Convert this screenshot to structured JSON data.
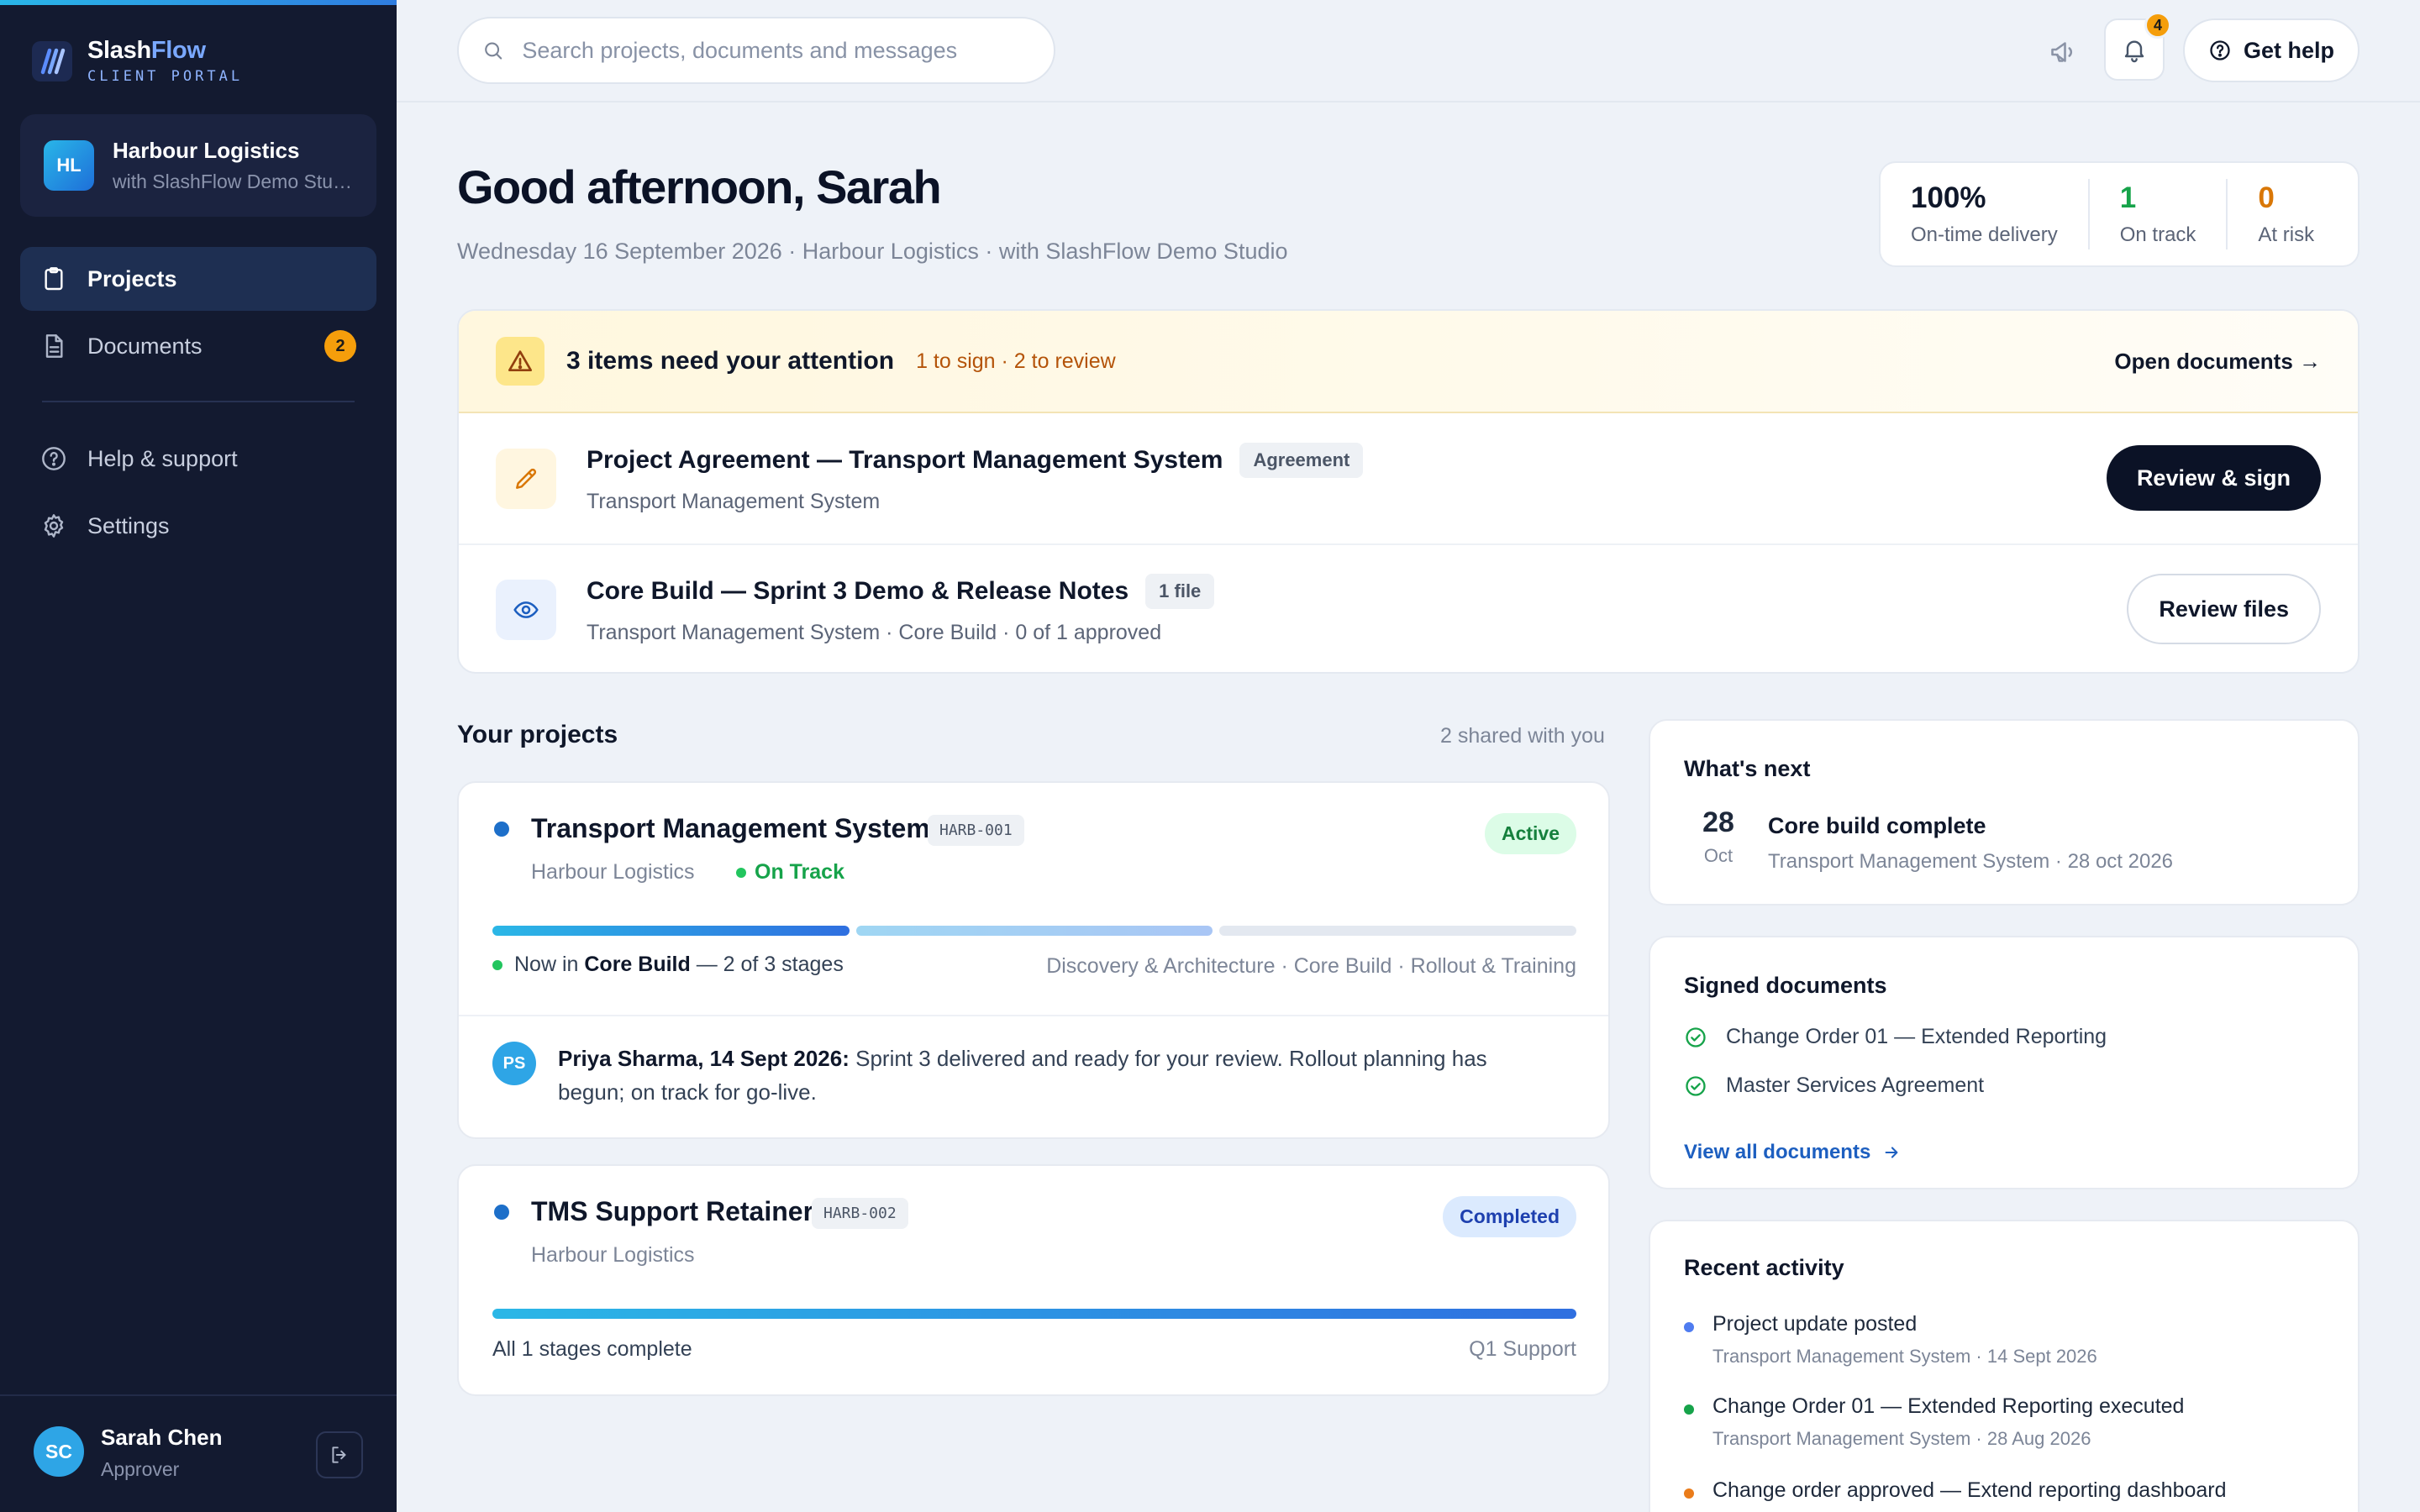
{
  "brand": {
    "name_part1": "Slash",
    "name_part2": "Flow",
    "subtitle": "CLIENT PORTAL"
  },
  "org": {
    "initials": "HL",
    "name": "Harbour Logistics",
    "subtitle": "with SlashFlow Demo Studio"
  },
  "nav": {
    "projects": "Projects",
    "documents": "Documents",
    "documents_badge": "2",
    "help": "Help & support",
    "settings": "Settings"
  },
  "user": {
    "initials": "SC",
    "name": "Sarah Chen",
    "role": "Approver"
  },
  "topbar": {
    "search_placeholder": "Search projects, documents and messages",
    "notification_count": "4",
    "help_label": "Get help"
  },
  "header": {
    "greeting": "Good afternoon, Sarah",
    "subline": "Wednesday 16 September 2026 · Harbour Logistics · with SlashFlow Demo Studio"
  },
  "kpis": [
    {
      "value": "100%",
      "label": "On-time delivery",
      "color": "#0f172a"
    },
    {
      "value": "1",
      "label": "On track",
      "color": "#16a34a"
    },
    {
      "value": "0",
      "label": "At risk",
      "color": "#d97706"
    }
  ],
  "attention": {
    "title": "3 items need your attention",
    "summary": "1 to sign · 2 to review",
    "open_link": "Open documents →",
    "items": [
      {
        "title": "Project Agreement — Transport Management System",
        "chip": "Agreement",
        "sub": "Transport Management System",
        "action": "Review & sign"
      },
      {
        "title": "Core Build — Sprint 3 Demo & Release Notes",
        "chip": "1 file",
        "sub": "Transport Management System · Core Build · 0 of 1 approved",
        "action": "Review files"
      }
    ]
  },
  "projects": {
    "title": "Your projects",
    "count": "2 shared with you",
    "items": [
      {
        "name": "Transport Management System",
        "code": "HARB-001",
        "client": "Harbour Logistics",
        "health": "On Track",
        "status": "Active",
        "stage_prefix": "Now in",
        "stage_current": "Core Build",
        "stage_suffix": "— 2 of 3 stages",
        "stages": "Discovery & Architecture · Core Build · Rollout & Training",
        "stages_complete": 1,
        "stages_in_progress": 1,
        "stages_total": 3,
        "update": {
          "initials": "PS",
          "author": "Priya Sharma, 14 Sept 2026:",
          "text": "Sprint 3 delivered and ready for your review. Rollout planning has begun; on track for go-live."
        }
      },
      {
        "name": "TMS Support Retainer",
        "code": "HARB-002",
        "client": "Harbour Logistics",
        "status": "Completed",
        "progress_label": "All 1 stages complete",
        "stages": "Q1 Support",
        "stages_complete": 1,
        "stages_total": 1
      }
    ]
  },
  "whats_next": {
    "title": "What's next",
    "day": "28",
    "month": "Oct",
    "event": "Core build complete",
    "sub": "Transport Management System · 28 oct 2026"
  },
  "signed": {
    "title": "Signed documents",
    "items": [
      "Change Order 01 — Extended Reporting",
      "Master Services Agreement"
    ],
    "view_all": "View all documents"
  },
  "activity": {
    "title": "Recent activity",
    "items": [
      {
        "title": "Project update posted",
        "sub": "Transport Management System · 14 Sept 2026",
        "color": "#4f7cf0"
      },
      {
        "title": "Change Order 01 — Extended Reporting executed",
        "sub": "Transport Management System · 28 Aug 2026",
        "color": "#16a34a"
      },
      {
        "title": "Change order approved — Extend reporting dashboard",
        "sub": "",
        "color": "#ea7c1a"
      }
    ]
  }
}
